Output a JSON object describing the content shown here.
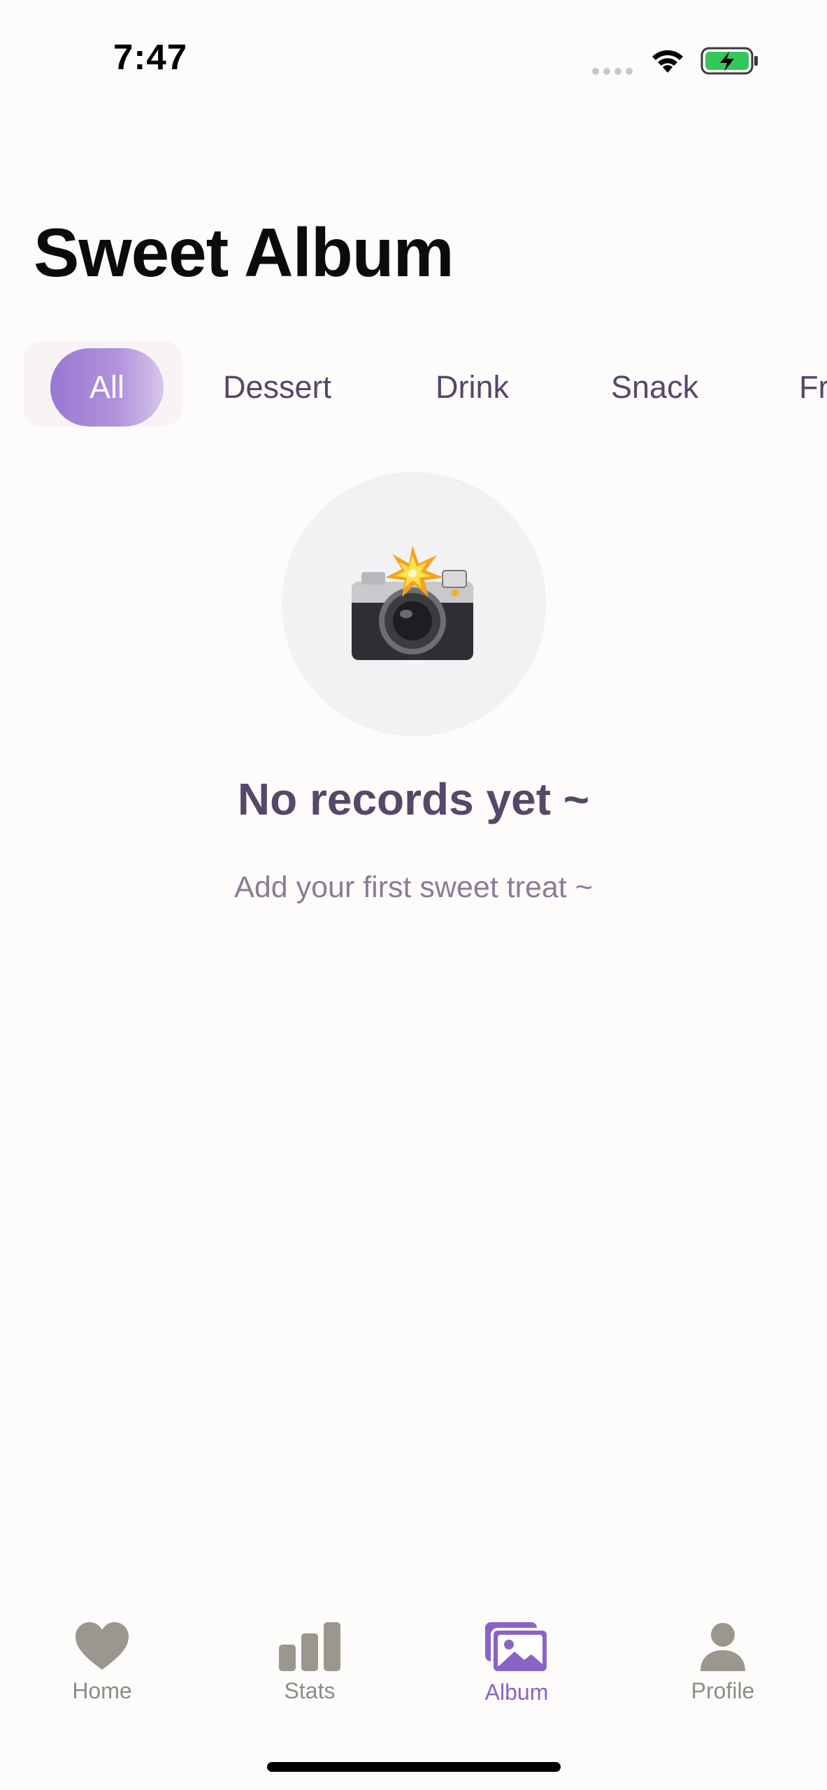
{
  "status_bar": {
    "time": "7:47",
    "icons": [
      "signal-dots-icon",
      "wifi-icon",
      "battery-charging-icon"
    ],
    "battery_color": "#34c759"
  },
  "header": {
    "title": "Sweet Album"
  },
  "categories": {
    "items": [
      "All",
      "Dessert",
      "Drink",
      "Snack",
      "Fr"
    ],
    "selected": "All",
    "accent": "#9a77d2"
  },
  "empty_state": {
    "icon": "camera-with-flash-icon",
    "title": "No records yet ~",
    "subtitle": "Add your first sweet treat ~"
  },
  "tab_bar": {
    "items": [
      {
        "label": "Home",
        "icon": "heart-icon"
      },
      {
        "label": "Stats",
        "icon": "bar-chart-icon"
      },
      {
        "label": "Album",
        "icon": "photo-album-icon"
      },
      {
        "label": "Profile",
        "icon": "person-icon"
      }
    ],
    "active": "Album",
    "active_color": "#8a63c6",
    "inactive_color": "#8e8c88"
  }
}
